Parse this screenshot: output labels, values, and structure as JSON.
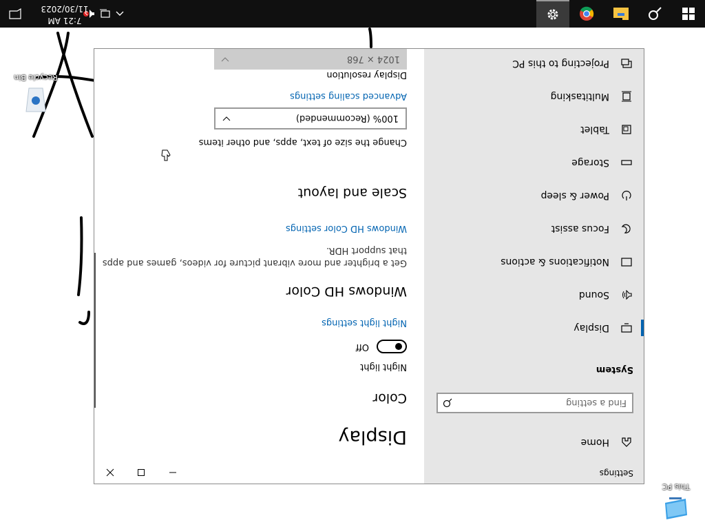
{
  "desktop": {
    "icons": [
      {
        "label": "This PC",
        "icon": "this-pc-icon"
      },
      {
        "label": "Recycle Bin",
        "icon": "recycle-bin-icon"
      }
    ]
  },
  "window": {
    "title": "Settings",
    "controls": {
      "minimize": "minimize-icon",
      "maximize": "maximize-icon",
      "close": "close-icon"
    }
  },
  "sidebar": {
    "home_label": "Home",
    "search_placeholder": "Find a setting",
    "section": "System",
    "items": [
      {
        "label": "Display",
        "icon": "monitor-icon",
        "selected": true
      },
      {
        "label": "Sound",
        "icon": "speaker-icon"
      },
      {
        "label": "Notifications & actions",
        "icon": "notification-icon"
      },
      {
        "label": "Focus assist",
        "icon": "moon-icon"
      },
      {
        "label": "Power & sleep",
        "icon": "power-icon"
      },
      {
        "label": "Storage",
        "icon": "storage-icon"
      },
      {
        "label": "Tablet",
        "icon": "tablet-icon"
      },
      {
        "label": "Multitasking",
        "icon": "multitasking-icon"
      },
      {
        "label": "Projecting to this PC",
        "icon": "projecting-icon"
      }
    ]
  },
  "content": {
    "page_title": "Display",
    "color_heading": "Color",
    "night_light_label": "Night light",
    "night_light_state": "Off",
    "night_light_link": "Night light settings",
    "hd_heading": "Windows HD Color",
    "hd_desc_line1": "Get a brighter and more vibrant picture for videos, games and apps",
    "hd_desc_line2": "that support HDR.",
    "hd_link": "Windows HD Color settings",
    "scale_heading": "Scale and layout",
    "scale_desc": "Change the size of text, apps, and other items",
    "scale_value": "100% (Recommended)",
    "adv_link": "Advanced scaling settings",
    "resolution_label": "Display resolution",
    "resolution_value": "1024 × 768"
  },
  "taskbar": {
    "start_icon": "windows-start-icon",
    "search_icon": "search-icon",
    "apps": [
      "file-explorer-icon",
      "chrome-icon",
      "settings-gear-icon"
    ],
    "active_app": "settings-gear-icon",
    "tray": [
      "chevron-up-icon",
      "network-icon",
      "volume-muted-icon"
    ],
    "time": "7:21 AM",
    "date": "11/30/2023",
    "notification_icon": "action-center-icon"
  },
  "colors": {
    "accent": "#0063b1",
    "taskbar": "#101010",
    "sidebar": "#e6e6e6"
  }
}
